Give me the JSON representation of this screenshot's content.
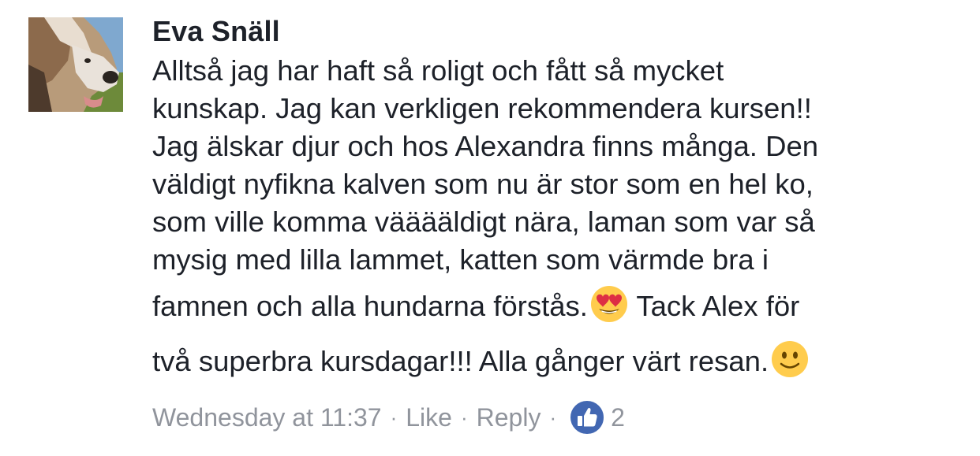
{
  "comment": {
    "author": "Eva Snäll",
    "avatar_icon": "dog-photo-avatar",
    "text_lines": [
      "Alltså jag har haft så roligt och fått så mycket",
      "kunskap. Jag kan verkligen rekommendera kursen!!",
      "Jag älskar djur och hos Alexandra finns många. Den",
      "väldigt nyfikna kalven som nu är stor som en hel ko,",
      "som ville komma vääääldigt nära, laman som var så",
      "mysig med lilla lammet, katten som värmde bra i",
      "famnen och alla hundarna förstås.",
      " Tack Alex för",
      "två superbra kursdagar!!! Alla gånger värt resan."
    ],
    "emojis": [
      "heart-eyes-emoji",
      "slightly-smiling-emoji"
    ]
  },
  "meta": {
    "timestamp": "Wednesday at 11:37",
    "separator": "·",
    "like_label": "Like",
    "reply_label": "Reply",
    "reaction_icon": "thumbs-up-icon",
    "reaction_count": "2"
  },
  "colors": {
    "text": "#1d2129",
    "meta": "#90949c",
    "like_blue": "#4267b2"
  }
}
